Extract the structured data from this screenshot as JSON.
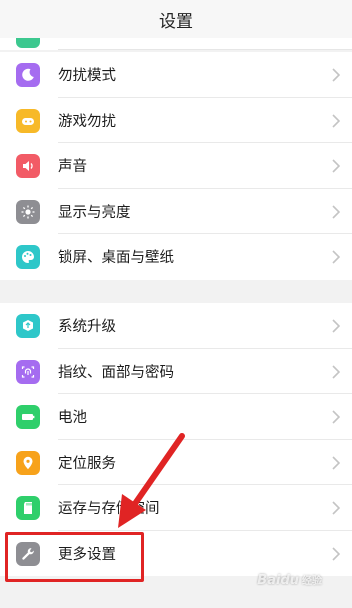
{
  "header": {
    "title": "设置"
  },
  "group1": [
    {
      "label": "勿扰模式",
      "icon": "moon-icon",
      "color": "#a56cf0"
    },
    {
      "label": "游戏勿扰",
      "icon": "game-controller-icon",
      "color": "#f7b928"
    },
    {
      "label": "声音",
      "icon": "speaker-icon",
      "color": "#f25b66"
    },
    {
      "label": "显示与亮度",
      "icon": "brightness-icon",
      "color": "#8e8e93"
    },
    {
      "label": "锁屏、桌面与壁纸",
      "icon": "palette-icon",
      "color": "#2ec7c9"
    }
  ],
  "group2": [
    {
      "label": "系统升级",
      "icon": "update-box-icon",
      "color": "#2ec7c9"
    },
    {
      "label": "指纹、面部与密码",
      "icon": "fingerprint-icon",
      "color": "#a56cf0"
    },
    {
      "label": "电池",
      "icon": "battery-icon",
      "color": "#2fcf6b"
    },
    {
      "label": "定位服务",
      "icon": "location-pin-icon",
      "color": "#f7a21b"
    },
    {
      "label": "运存与存储空间",
      "icon": "sd-card-icon",
      "color": "#2fcf6b"
    },
    {
      "label": "更多设置",
      "icon": "wrench-icon",
      "color": "#8e8e93"
    }
  ],
  "watermark": {
    "brand": "Bai",
    "paw": "du",
    "sub": "经验"
  },
  "annotation": {
    "color": "#e02424"
  }
}
